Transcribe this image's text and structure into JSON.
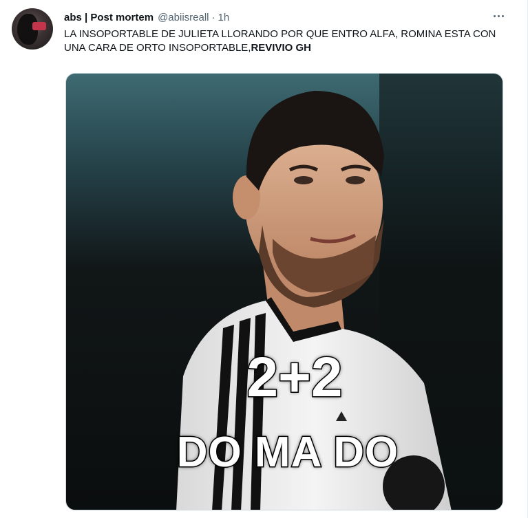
{
  "tweet": {
    "display_name": "abs | Post mortem",
    "handle": "@abiisreall",
    "separator": "·",
    "time": "1h",
    "more_icon": "more-horizontal-icon",
    "text_main": "LA INSOPORTABLE DE JULIETA LLORANDO POR QUE ENTRO ALFA, ROMINA ESTA CON UNA CARA DE ORTO INSOPORTABLE,",
    "text_bold": "REVIVIO GH"
  },
  "media": {
    "caption_top": "2+2",
    "caption_bottom": "DO MA DO"
  },
  "colors": {
    "text": "#0f1419",
    "secondary": "#536471",
    "border": "#cfd9de"
  }
}
